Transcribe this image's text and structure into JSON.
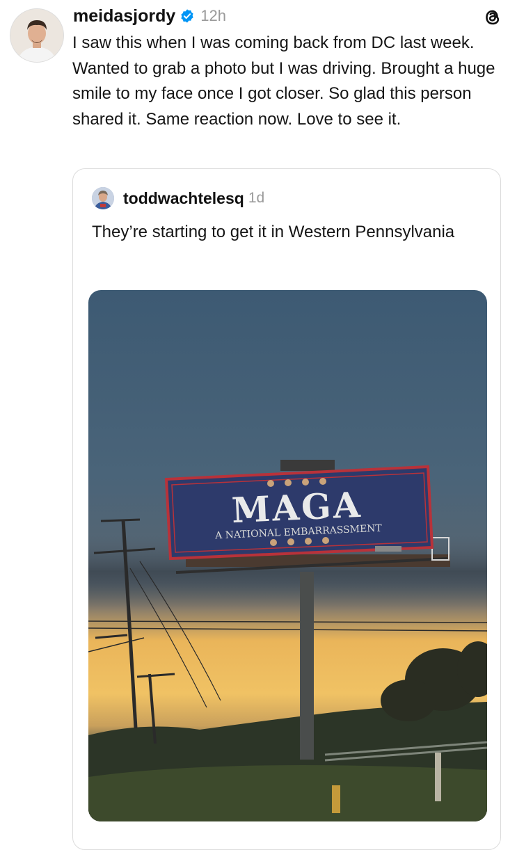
{
  "post": {
    "username": "meidasjordy",
    "time": "12h",
    "text": "I saw this when I was coming back from DC last week. Wanted to grab a photo but I was driving. Brought a huge smile to my face once I got closer. So glad this person shared it. Same reaction now. Love to see it."
  },
  "quoted_post": {
    "username": "toddwachtelesq",
    "time": "1d",
    "text": "They’re starting to get it in Western Pennsylvania",
    "image": {
      "billboard_title": "MAGA",
      "billboard_subtitle": "A NATIONAL EMBARRASSMENT"
    }
  },
  "icons": {
    "verified": "verified-badge-icon",
    "app": "threads-logo-icon"
  },
  "colors": {
    "verified_blue": "#0095f6",
    "billboard_navy": "#2d3a6b",
    "billboard_red": "#b8323a",
    "sunset_yellow": "#f2c15a"
  }
}
